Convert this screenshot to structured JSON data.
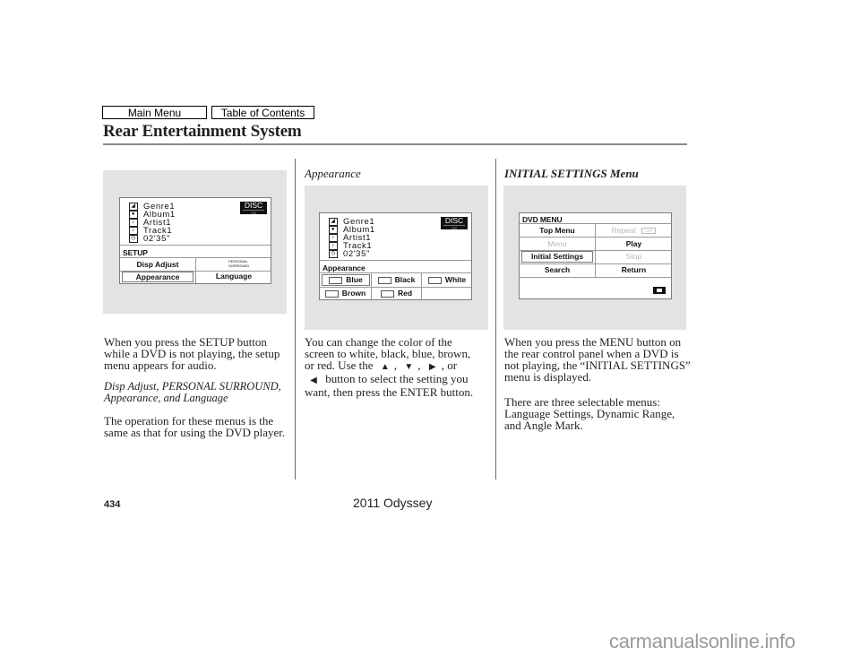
{
  "nav": {
    "main_menu": "Main Menu",
    "table_of_contents": "Table of Contents"
  },
  "header": {
    "title": "Rear Entertainment System"
  },
  "left_column": {
    "screen": {
      "meta": {
        "genre": "Genre1",
        "album": "Album1",
        "artist": "Artist1",
        "track": "Track1",
        "time": "02'35\""
      },
      "disc_badge": "DISC",
      "disc_sub": "CD",
      "label": "SETUP",
      "items": {
        "disp_adjust": "Disp Adjust",
        "personal_surround_1": "PERSONAL",
        "personal_surround_2": "SURROUND",
        "appearance": "Appearance",
        "language": "Language"
      }
    },
    "para1": "When you press the SETUP button while a DVD is not playing, the setup menu appears for audio.",
    "subhead_line1": "Disp Adjust, PERSONAL SURROUND,",
    "subhead_line2": "Appearance, and Language",
    "para2": "The operation for these menus is the same as that for using the DVD player."
  },
  "middle_column": {
    "section_title": "Appearance",
    "screen": {
      "meta": {
        "genre": "Genre1",
        "album": "Album1",
        "artist": "Artist1",
        "track": "Track1",
        "time": "02'35\""
      },
      "disc_badge": "DISC",
      "disc_sub": "CD",
      "label": "Appearance",
      "colors": {
        "blue": "Blue",
        "black": "Black",
        "white": "White",
        "brown": "Brown",
        "red": "Red"
      }
    },
    "para_line1": "You can change the color of the",
    "para_line2": "screen to white, black, blue, brown,",
    "para_line3a": "or red. Use the",
    "para_line3b": ", or",
    "para_line4": "button to select the setting you",
    "para_line5": "want, then press the ENTER button.",
    "arrows": {
      "up": "▲",
      "down": "▼",
      "right": "▶",
      "left": "◀",
      "sep": ","
    }
  },
  "right_column": {
    "section_title": "INITIAL SETTINGS Menu",
    "screen": {
      "label": "DVD MENU",
      "items": {
        "top_menu": "Top Menu",
        "repeat": "Repeat",
        "repeat_state": "OFF",
        "menu": "Menu",
        "play": "Play",
        "initial_settings": "Initial Settings",
        "stop": "Stop",
        "search": "Search",
        "return": "Return"
      }
    },
    "para1": "When you press the MENU button on the rear control panel when a DVD is not playing, the “INITIAL SETTINGS” menu is displayed.",
    "para2": "There are three selectable menus: Language Settings, Dynamic Range, and Angle Mark."
  },
  "footer": {
    "page_number": "434",
    "model": "2011 Odyssey",
    "watermark": "carmanualsonline.info"
  }
}
